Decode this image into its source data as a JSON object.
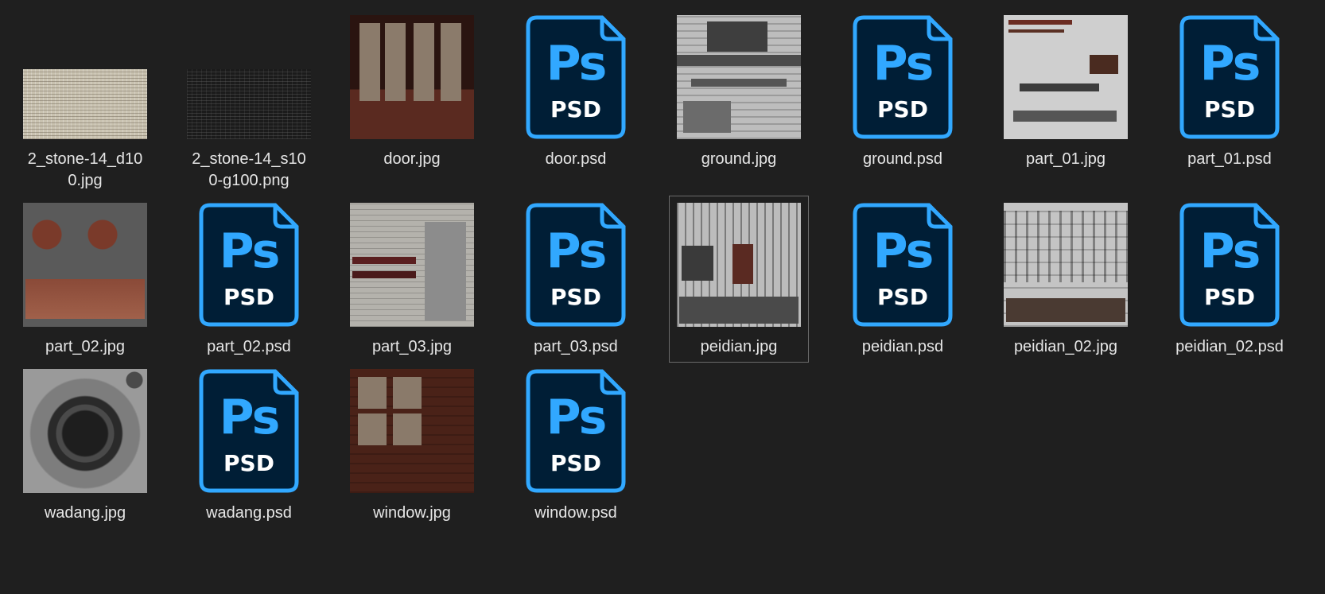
{
  "colors": {
    "background": "#1f1f1f",
    "psd_fill": "#001e36",
    "psd_accent": "#31a8ff"
  },
  "psd_icon": {
    "big": "Ps",
    "small": "PSD",
    "icon": "photoshop-psd-icon"
  },
  "files": [
    {
      "name": "2_stone-14_d10\n0.jpg",
      "kind": "img",
      "thumb": "stone-light"
    },
    {
      "name": "2_stone-14_s10\n0-g100.png",
      "kind": "img",
      "thumb": "stone-dark"
    },
    {
      "name": "door.jpg",
      "kind": "img",
      "thumb": "door"
    },
    {
      "name": "door.psd",
      "kind": "psd"
    },
    {
      "name": "ground.jpg",
      "kind": "img",
      "thumb": "ground"
    },
    {
      "name": "ground.psd",
      "kind": "psd"
    },
    {
      "name": "part_01.jpg",
      "kind": "img",
      "thumb": "part01"
    },
    {
      "name": "part_01.psd",
      "kind": "psd"
    },
    {
      "name": "part_02.jpg",
      "kind": "img",
      "thumb": "part02"
    },
    {
      "name": "part_02.psd",
      "kind": "psd"
    },
    {
      "name": "part_03.jpg",
      "kind": "img",
      "thumb": "part03"
    },
    {
      "name": "part_03.psd",
      "kind": "psd"
    },
    {
      "name": "peidian.jpg",
      "kind": "img",
      "thumb": "peidian",
      "selected": true
    },
    {
      "name": "peidian.psd",
      "kind": "psd"
    },
    {
      "name": "peidian_02.jpg",
      "kind": "img",
      "thumb": "peidian02"
    },
    {
      "name": "peidian_02.psd",
      "kind": "psd"
    },
    {
      "name": "wadang.jpg",
      "kind": "img",
      "thumb": "wadang"
    },
    {
      "name": "wadang.psd",
      "kind": "psd"
    },
    {
      "name": "window.jpg",
      "kind": "img",
      "thumb": "window"
    },
    {
      "name": "window.psd",
      "kind": "psd"
    }
  ]
}
